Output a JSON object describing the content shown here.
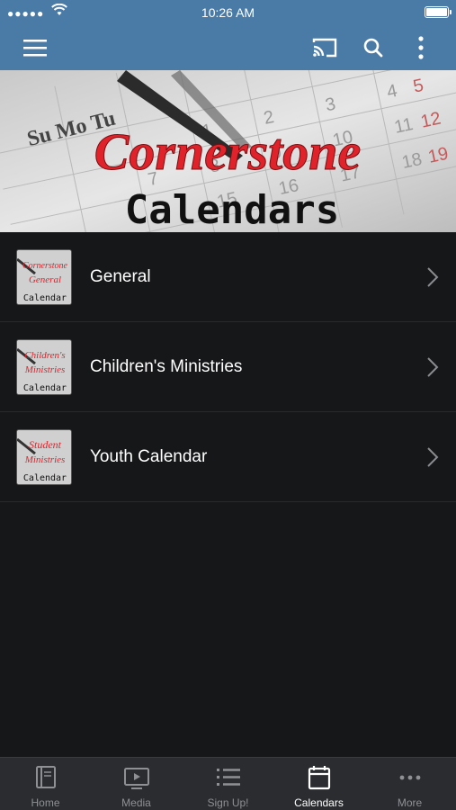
{
  "status_bar": {
    "signal": "●●●●●",
    "time": "10:26 AM"
  },
  "nav": {
    "menu_icon": "hamburger-menu-icon",
    "cast_icon": "cast-icon",
    "search_icon": "search-icon",
    "more_icon": "vertical-dots-icon"
  },
  "banner": {
    "title": "Cornerstone",
    "subtitle": "Calendars",
    "calendar_letters": "Su Mo Tu"
  },
  "calendars": [
    {
      "label": "General",
      "thumb_line1": "Cornerstone",
      "thumb_line2": "General",
      "thumb_line3": "Calendar"
    },
    {
      "label": "Children's Ministries",
      "thumb_line1": "Children's",
      "thumb_line2": "Ministries",
      "thumb_line3": "Calendar"
    },
    {
      "label": "Youth Calendar",
      "thumb_line1": "Student",
      "thumb_line2": "Ministries",
      "thumb_line3": "Calendar"
    }
  ],
  "tabs": [
    {
      "label": "Home",
      "icon": "book-icon"
    },
    {
      "label": "Media",
      "icon": "play-screen-icon"
    },
    {
      "label": "Sign Up!",
      "icon": "list-icon"
    },
    {
      "label": "Calendars",
      "icon": "calendar-icon",
      "active": true
    },
    {
      "label": "More",
      "icon": "horizontal-dots-icon"
    }
  ],
  "colors": {
    "header": "#4a7aa6",
    "background": "#161719",
    "tab_bar": "#2a2c30",
    "accent_red": "#e0232b"
  }
}
